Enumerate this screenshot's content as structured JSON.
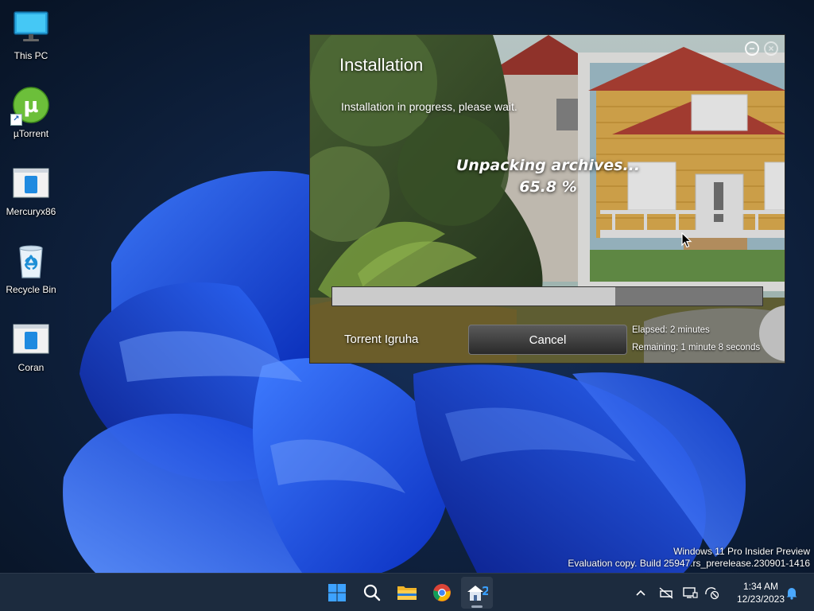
{
  "desktop": {
    "icons": [
      {
        "label": "This PC",
        "icon": "monitor-icon"
      },
      {
        "label": "µTorrent",
        "icon": "utorrent-icon"
      },
      {
        "label": "Mercuryx86",
        "icon": "app-icon"
      },
      {
        "label": "Recycle Bin",
        "icon": "recycle-bin-icon"
      },
      {
        "label": "Coran",
        "icon": "app-icon"
      }
    ]
  },
  "installer": {
    "title": "Installation",
    "subtitle": "Installation in progress, please wait.",
    "status": "Unpacking archives...",
    "percent_label": "65.8 %",
    "progress": 0.658,
    "brand": "Torrent Igruha",
    "cancel_label": "Cancel",
    "elapsed": "Elapsed:  2 minutes",
    "remaining": "Remaining:  1 minute 8 seconds",
    "minimize_glyph": "−",
    "close_glyph": "×"
  },
  "watermark": {
    "line1": "Windows 11 Pro Insider Preview",
    "line2": "Evaluation copy. Build 25947.rs_prerelease.230901-1416"
  },
  "taskbar": {
    "apps": [
      "start-icon",
      "search-icon",
      "file-explorer-icon",
      "chrome-icon",
      "installer-app-icon"
    ],
    "time": "1:34 AM",
    "date": "12/23/2023",
    "tray": [
      "chevron-up-icon",
      "network-off-icon",
      "display-icon",
      "settings-off-icon",
      "bell-icon"
    ]
  },
  "colors": {
    "wallpaper_dark": "#0b1a33",
    "bloom_blue": "#1a55e8",
    "taskbar": "#1c2b3e"
  }
}
